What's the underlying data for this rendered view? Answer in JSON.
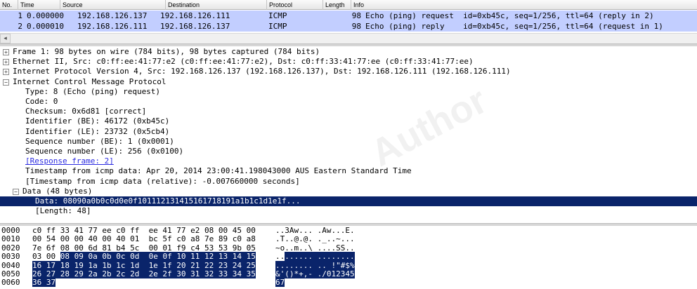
{
  "packet_list": {
    "columns": [
      "No.",
      "Time",
      "Source",
      "Destination",
      "Protocol",
      "Length",
      "Info"
    ],
    "rows": [
      {
        "no": "1",
        "time": "0.000000",
        "source": "192.168.126.137",
        "destination": "192.168.126.111",
        "protocol": "ICMP",
        "length": "98",
        "info": "Echo (ping) request  id=0xb45c, seq=1/256, ttl=64 (reply in 2)"
      },
      {
        "no": "2",
        "time": "0.000010",
        "source": "192.168.126.111",
        "destination": "192.168.126.137",
        "protocol": "ICMP",
        "length": "98",
        "info": "Echo (ping) reply    id=0xb45c, seq=1/256, ttl=64 (request in 1)"
      }
    ],
    "scroll_left_glyph": "◂"
  },
  "detail_tree": [
    {
      "indent": 0,
      "toggle": "+",
      "text": "Frame 1: 98 bytes on wire (784 bits), 98 bytes captured (784 bits)"
    },
    {
      "indent": 0,
      "toggle": "+",
      "text": "Ethernet II, Src: c0:ff:ee:41:77:e2 (c0:ff:ee:41:77:e2), Dst: c0:ff:33:41:77:ee (c0:ff:33:41:77:ee)"
    },
    {
      "indent": 0,
      "toggle": "+",
      "text": "Internet Protocol Version 4, Src: 192.168.126.137 (192.168.126.137), Dst: 192.168.126.111 (192.168.126.111)"
    },
    {
      "indent": 0,
      "toggle": "−",
      "text": "Internet Control Message Protocol"
    },
    {
      "indent": 1,
      "toggle": "",
      "text": "Type: 8 (Echo (ping) request)"
    },
    {
      "indent": 1,
      "toggle": "",
      "text": "Code: 0"
    },
    {
      "indent": 1,
      "toggle": "",
      "text": "Checksum: 0x6d81 [correct]"
    },
    {
      "indent": 1,
      "toggle": "",
      "text": "Identifier (BE): 46172 (0xb45c)"
    },
    {
      "indent": 1,
      "toggle": "",
      "text": "Identifier (LE): 23732 (0x5cb4)"
    },
    {
      "indent": 1,
      "toggle": "",
      "text": "Sequence number (BE): 1 (0x0001)"
    },
    {
      "indent": 1,
      "toggle": "",
      "text": "Sequence number (LE): 256 (0x0100)"
    },
    {
      "indent": 1,
      "toggle": "",
      "text": "[Response frame: 2]",
      "link": true
    },
    {
      "indent": 1,
      "toggle": "",
      "text": "Timestamp from icmp data: Apr 20, 2014 23:00:41.198043000 AUS Eastern Standard Time"
    },
    {
      "indent": 1,
      "toggle": "",
      "text": "[Timestamp from icmp data (relative): -0.007660000 seconds]"
    },
    {
      "indent": 1,
      "toggle": "−",
      "text": "Data (48 bytes)"
    },
    {
      "indent": 2,
      "toggle": "",
      "text": "Data: 08090a0b0c0d0e0f101112131415161718191a1b1c1d1e1f...",
      "selected": true
    },
    {
      "indent": 2,
      "toggle": "",
      "text": "[Length: 48]"
    }
  ],
  "hex_dump": [
    {
      "offset": "0000",
      "bytes": "c0 ff 33 41 77 ee c0 ff  ee 41 77 e2 08 00 45 00",
      "hl_start": -1,
      "hl_end": -1,
      "ascii": "..3Aw... .Aw...E."
    },
    {
      "offset": "0010",
      "bytes": "00 54 00 00 40 00 40 01  bc 5f c0 a8 7e 89 c0 a8",
      "hl_start": -1,
      "hl_end": -1,
      "ascii": ".T..@.@. ._..~..."
    },
    {
      "offset": "0020",
      "bytes": "7e 6f 08 00 6d 81 b4 5c  00 01 f9 c4 53 53 9b 05",
      "hl_start": -1,
      "hl_end": -1,
      "ascii": "~o..m..\\ ....SS.."
    },
    {
      "offset": "0030",
      "bytes": "03 00 08 09 0a 0b 0c 0d  0e 0f 10 11 12 13 14 15",
      "hl_start": 6,
      "hl_end": 48,
      "ascii": "........ ........"
    },
    {
      "offset": "0040",
      "bytes": "16 17 18 19 1a 1b 1c 1d  1e 1f 20 21 22 23 24 25",
      "hl_start": 0,
      "hl_end": 48,
      "ascii": "........ .. !\"#$%"
    },
    {
      "offset": "0050",
      "bytes": "26 27 28 29 2a 2b 2c 2d  2e 2f 30 31 32 33 34 35",
      "hl_start": 0,
      "hl_end": 48,
      "ascii": "&'()*+,- ./012345"
    },
    {
      "offset": "0060",
      "bytes": "36 37",
      "hl_start": 0,
      "hl_end": 5,
      "ascii": "67"
    }
  ],
  "watermark": "Author"
}
